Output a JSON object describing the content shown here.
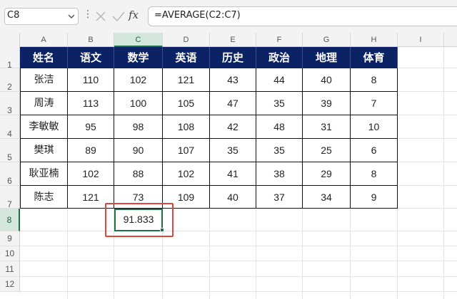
{
  "formula_bar": {
    "name_box": "C8",
    "formula": "=AVERAGE(C2:C7)",
    "fx_label": "fx",
    "menu_dots": "⋮"
  },
  "columns": [
    "A",
    "B",
    "C",
    "D",
    "E",
    "F",
    "G",
    "H",
    "I"
  ],
  "rows": [
    "1",
    "2",
    "3",
    "4",
    "5",
    "6",
    "7",
    "8",
    "9",
    "10",
    "11",
    "12"
  ],
  "table": {
    "headers": [
      "姓名",
      "语文",
      "数学",
      "英语",
      "历史",
      "政治",
      "地理",
      "体育"
    ],
    "data": [
      [
        "张洁",
        "110",
        "102",
        "121",
        "43",
        "44",
        "40",
        "8"
      ],
      [
        "周涛",
        "113",
        "100",
        "105",
        "47",
        "35",
        "39",
        "7"
      ],
      [
        "李敏敏",
        "95",
        "98",
        "108",
        "42",
        "48",
        "31",
        "10"
      ],
      [
        "樊琪",
        "89",
        "90",
        "107",
        "35",
        "35",
        "25",
        "6"
      ],
      [
        "耿亚楠",
        "102",
        "88",
        "102",
        "41",
        "38",
        "29",
        "8"
      ],
      [
        "陈志",
        "121",
        "73",
        "109",
        "40",
        "37",
        "34",
        "9"
      ]
    ],
    "result": "91.833"
  },
  "colors": {
    "header_bg": "#0b2265",
    "selection": "#1f7145",
    "highlight": "#e0453a"
  },
  "icons": {
    "cancel": "x-icon",
    "enter": "check-icon",
    "dropdown": "chevron-down-icon"
  }
}
